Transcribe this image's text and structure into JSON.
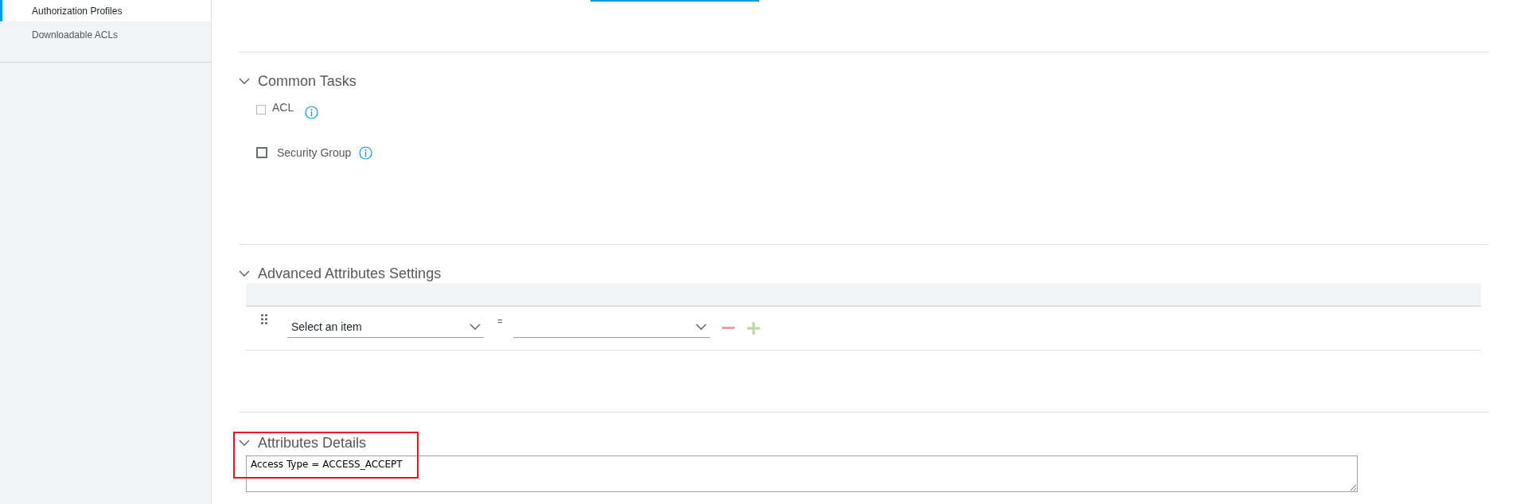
{
  "sidebar": {
    "items": [
      {
        "label": "Authorization Profiles",
        "selected": true
      },
      {
        "label": "Downloadable ACLs",
        "selected": false
      }
    ]
  },
  "sections": [
    {
      "title": "Common Tasks",
      "expanded": true,
      "kind": "tasks",
      "tasks": [
        {
          "label": "ACL",
          "checked": false,
          "disabled": true
        },
        {
          "label": "Security Group",
          "checked": false,
          "disabled": false
        }
      ]
    },
    {
      "title": "Advanced Attributes Settings",
      "expanded": true,
      "kind": "attributes",
      "rows": [
        {
          "attribute": "Select an item",
          "operator": "=",
          "value": ""
        }
      ]
    },
    {
      "title": "Attributes Details",
      "expanded": true,
      "kind": "details",
      "text": "Access Type = ACCESS_ACCEPT",
      "highlighted": true
    }
  ]
}
